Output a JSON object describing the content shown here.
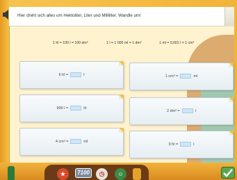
{
  "instruction": "Hier dreht sich alles um Hektoliter, Liter und Milliliter. Wandle um!",
  "formulas": [
    "1 hl = 100 l = 100 dm³",
    "1 l = 1 000 ml = 1 dm³",
    "1 ml = 0,001 l = 1 cm³"
  ],
  "exercises": [
    {
      "left": "6 hl =",
      "right": "l"
    },
    {
      "left": "1 cm³ =",
      "right": "ml"
    },
    {
      "left": "900 l =",
      "right": "hl"
    },
    {
      "left": "2 dm³ =",
      "right": "l"
    },
    {
      "left": "4 cm³ =",
      "right": "ml"
    },
    {
      "left": "9 hl =",
      "right": "l"
    }
  ],
  "toolbar": {
    "timer": "7100"
  },
  "colors": {
    "frame": "#f4b83d",
    "answer_box": "#cfe6f6",
    "card": "#eef3f6"
  }
}
